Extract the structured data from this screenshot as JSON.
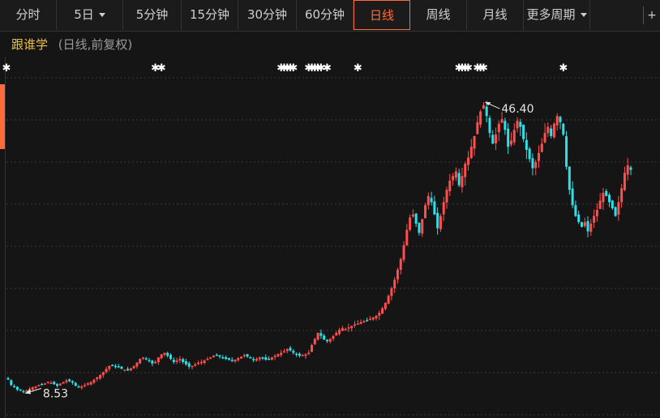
{
  "period_tabs": [
    {
      "label": "分时",
      "dropdown": false,
      "active": false
    },
    {
      "label": "5日",
      "dropdown": true,
      "active": false
    },
    {
      "label": "5分钟",
      "dropdown": false,
      "active": false
    },
    {
      "label": "15分钟",
      "dropdown": false,
      "active": false
    },
    {
      "label": "30分钟",
      "dropdown": false,
      "active": false
    },
    {
      "label": "60分钟",
      "dropdown": false,
      "active": false
    },
    {
      "label": "日线",
      "dropdown": false,
      "active": true
    },
    {
      "label": "周线",
      "dropdown": false,
      "active": false
    },
    {
      "label": "月线",
      "dropdown": false,
      "active": false
    },
    {
      "label": "更多周期",
      "dropdown": true,
      "active": false
    }
  ],
  "corner_button": "+",
  "indicator": {
    "name": "跟谁学",
    "params": "(日线,前复权)"
  },
  "colors": {
    "up": "#ff4e4e",
    "down": "#2ee0e8",
    "active": "#ff6a3c",
    "marker": "#ffffff"
  },
  "chart_data": {
    "type": "candlestick",
    "period": "日线",
    "adjustment": "前复权",
    "ylim": [
      7,
      50
    ],
    "grid": true,
    "high_label": "46.40",
    "low_label": "8.53",
    "high_value": 46.4,
    "low_value": 8.53,
    "closes": [
      10.3,
      9.6,
      9.4,
      9.0,
      8.9,
      8.8,
      8.9,
      9.1,
      9.3,
      9.4,
      9.6,
      9.7,
      9.8,
      10.0,
      9.9,
      9.7,
      9.5,
      9.8,
      10.0,
      10.2,
      10.1,
      9.9,
      9.5,
      9.3,
      9.4,
      9.6,
      9.8,
      10.0,
      10.3,
      10.6,
      10.9,
      11.3,
      11.7,
      12.1,
      12.2,
      12.0,
      11.9,
      11.7,
      11.6,
      11.5,
      11.8,
      12.1,
      12.5,
      13.0,
      13.2,
      13.0,
      12.7,
      12.4,
      12.6,
      13.2,
      13.6,
      13.8,
      13.4,
      13.0,
      12.6,
      12.8,
      13.0,
      12.6,
      12.3,
      12.0,
      12.1,
      12.3,
      12.5,
      12.6,
      12.8,
      13.0,
      13.2,
      13.4,
      13.5,
      13.3,
      13.1,
      13.0,
      12.9,
      12.8,
      12.9,
      13.1,
      13.3,
      13.5,
      13.3,
      13.1,
      12.9,
      13.0,
      13.2,
      13.1,
      12.9,
      13.0,
      13.2,
      13.4,
      13.6,
      13.8,
      14.0,
      14.3,
      14.1,
      13.8,
      13.6,
      13.4,
      13.5,
      13.6,
      13.8,
      14.8,
      15.6,
      16.4,
      16.0,
      15.5,
      15.3,
      15.6,
      16.0,
      16.4,
      16.8,
      17.0,
      16.9,
      17.1,
      17.3,
      17.5,
      17.6,
      17.8,
      17.9,
      18.0,
      18.2,
      18.4,
      18.6,
      19.0,
      19.6,
      20.3,
      21.2,
      22.2,
      23.3,
      24.6,
      26.0,
      27.8,
      29.8,
      31.4,
      31.8,
      30.6,
      29.4,
      31.2,
      33.0,
      34.2,
      33.4,
      31.8,
      30.0,
      31.6,
      33.4,
      35.0,
      36.2,
      36.8,
      37.4,
      35.6,
      36.8,
      38.4,
      39.2,
      40.6,
      42.0,
      43.8,
      45.2,
      46.0,
      44.6,
      42.4,
      41.0,
      42.2,
      43.6,
      44.2,
      42.8,
      40.6,
      41.4,
      42.8,
      44.0,
      43.2,
      41.6,
      40.2,
      39.0,
      37.8,
      38.6,
      39.8,
      41.0,
      42.4,
      43.2,
      42.0,
      43.6,
      44.6,
      43.8,
      42.2,
      38.0,
      35.0,
      33.0,
      31.6,
      30.8,
      30.2,
      30.8,
      29.6,
      30.6,
      31.6,
      32.4,
      33.6,
      34.6,
      34.2,
      33.4,
      32.6,
      31.6,
      33.4,
      35.2,
      37.2,
      38.2,
      37.6
    ],
    "signal_markers": [
      0,
      48,
      50,
      89,
      90,
      91,
      92,
      93,
      98,
      99,
      100,
      101,
      102,
      104,
      114,
      147,
      148,
      149,
      150,
      153,
      154,
      155,
      181
    ]
  }
}
